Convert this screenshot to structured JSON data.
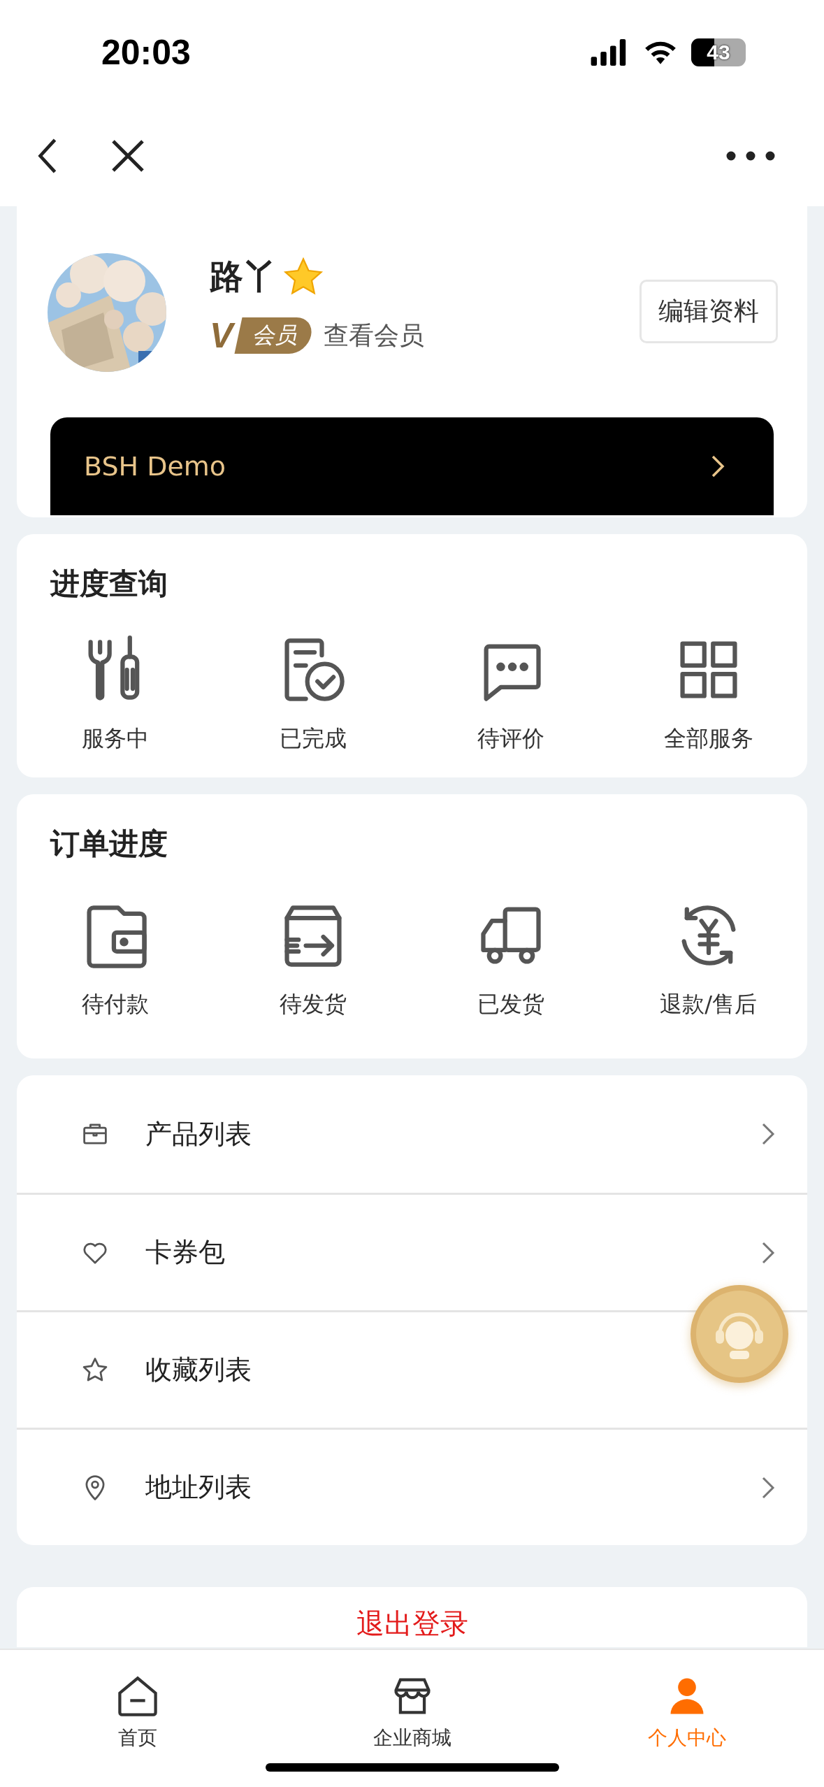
{
  "status_bar": {
    "time": "20:03",
    "battery": "43"
  },
  "profile": {
    "name": "路丫",
    "member_mark": "V",
    "member_badge": "会员",
    "member_link": "查看会员",
    "edit_button": "编辑资料",
    "company": "BSH Demo"
  },
  "progress": {
    "title": "进度查询",
    "items": [
      "服务中",
      "已完成",
      "待评价",
      "全部服务"
    ]
  },
  "orders": {
    "title": "订单进度",
    "items": [
      "待付款",
      "待发货",
      "已发货",
      "退款/售后"
    ]
  },
  "menu": [
    "产品列表",
    "卡券包",
    "收藏列表",
    "地址列表"
  ],
  "logout": "退出登录",
  "tabs": [
    {
      "label": "首页",
      "selected": false
    },
    {
      "label": "企业商城",
      "selected": false
    },
    {
      "label": "个人中心",
      "selected": true
    }
  ]
}
